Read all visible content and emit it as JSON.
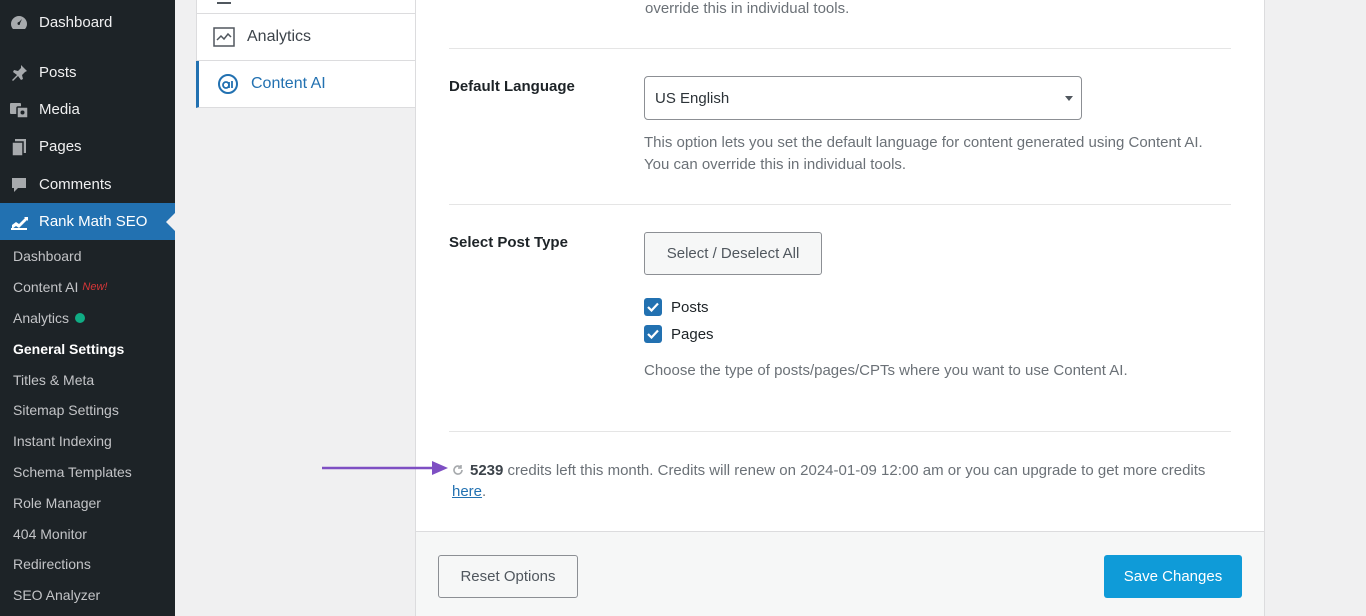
{
  "sidebar": {
    "top_items": [
      {
        "label": "Dashboard",
        "icon": "dashboard-icon"
      },
      {
        "label": "Posts",
        "icon": "pin-icon"
      },
      {
        "label": "Media",
        "icon": "media-icon"
      },
      {
        "label": "Pages",
        "icon": "pages-icon"
      },
      {
        "label": "Comments",
        "icon": "comment-icon"
      },
      {
        "label": "Rank Math SEO",
        "icon": "rank-math-icon"
      }
    ],
    "sub_items": [
      {
        "label": "Dashboard"
      },
      {
        "label": "Content AI",
        "badge": "New!"
      },
      {
        "label": "Analytics"
      },
      {
        "label": "General Settings"
      },
      {
        "label": "Titles & Meta"
      },
      {
        "label": "Sitemap Settings"
      },
      {
        "label": "Instant Indexing"
      },
      {
        "label": "Schema Templates"
      },
      {
        "label": "Role Manager"
      },
      {
        "label": "404 Monitor"
      },
      {
        "label": "Redirections"
      },
      {
        "label": "SEO Analyzer"
      }
    ],
    "colors": {
      "bg": "#1d2327",
      "active": "#2271b1",
      "new_badge": "#d63638",
      "analytics_dot": "#10ac84"
    }
  },
  "tabs": [
    {
      "label": "Analytics",
      "icon": "analytics-chart-icon"
    },
    {
      "label": "Content AI",
      "icon": "content-ai-icon"
    }
  ],
  "settings": {
    "top_desc": "override this in individual tools.",
    "language": {
      "label": "Default Language",
      "value": "US English",
      "desc_line1": "This option lets you set the default language for content generated using Content AI.",
      "desc_line2": "You can override this in individual tools."
    },
    "post_type": {
      "label": "Select Post Type",
      "toggle_button": "Select / Deselect All",
      "options": [
        {
          "label": "Posts",
          "checked": true
        },
        {
          "label": "Pages",
          "checked": true
        }
      ],
      "desc": "Choose the type of posts/pages/CPTs where you want to use Content AI."
    },
    "credits": {
      "count": "5239",
      "text": "credits left this month. Credits will renew on 2024-01-09 12:00 am or you can upgrade to get more credits",
      "link": "here",
      "end": "."
    }
  },
  "footer": {
    "reset_label": "Reset Options",
    "save_label": "Save Changes"
  },
  "accent_color": "#0f9bd8",
  "arrow_color": "#7e4fc3"
}
